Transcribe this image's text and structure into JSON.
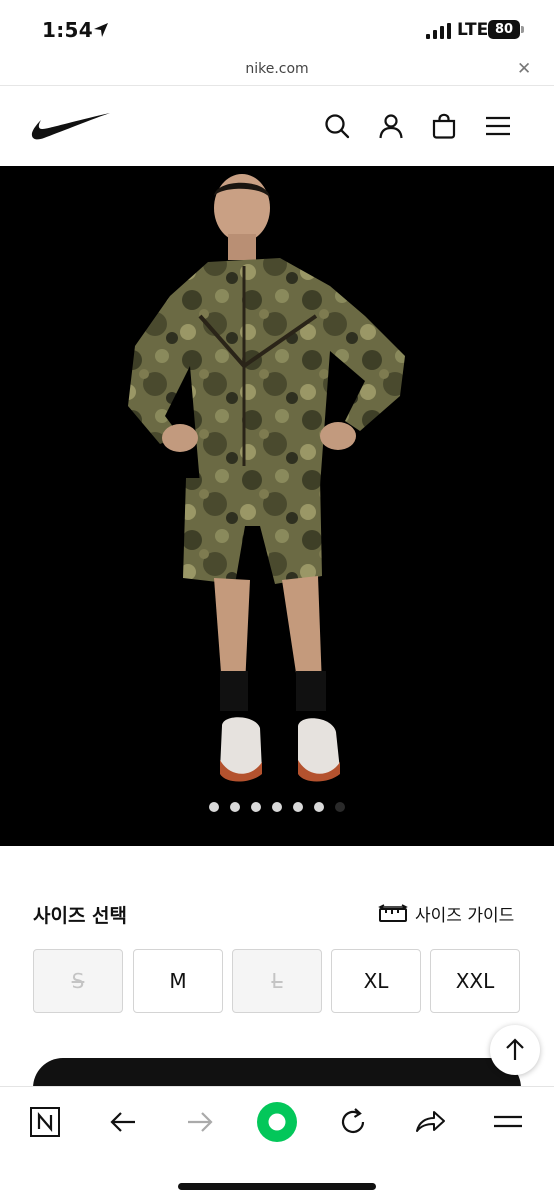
{
  "status_bar": {
    "time": "1:54",
    "network": "LTE",
    "battery": "80"
  },
  "url_bar": {
    "domain": "nike.com",
    "close_glyph": "✕"
  },
  "header": {
    "logo": "nike-swoosh-logo",
    "icons": [
      "search-icon",
      "account-icon",
      "bag-icon",
      "menu-icon"
    ]
  },
  "product_image": {
    "carousel_count": 7,
    "active_dots": 6
  },
  "size_selector": {
    "title": "사이즈 선택",
    "guide_label": "사이즈 가이드",
    "sizes": [
      {
        "label": "S",
        "available": false
      },
      {
        "label": "M",
        "available": true
      },
      {
        "label": "L",
        "available": false
      },
      {
        "label": "XL",
        "available": true
      },
      {
        "label": "XXL",
        "available": true
      }
    ]
  },
  "toolbar": {
    "icons": [
      "naver-n-icon",
      "back-arrow-icon",
      "forward-arrow-icon",
      "green-circle-icon",
      "reload-icon",
      "share-icon",
      "menu-icon"
    ],
    "accent": "#03c75a"
  },
  "colors": {
    "image_bg": "#000000",
    "text": "#111111",
    "disabled_bg": "#f5f5f5",
    "disabled_text": "#c4c4c4"
  }
}
